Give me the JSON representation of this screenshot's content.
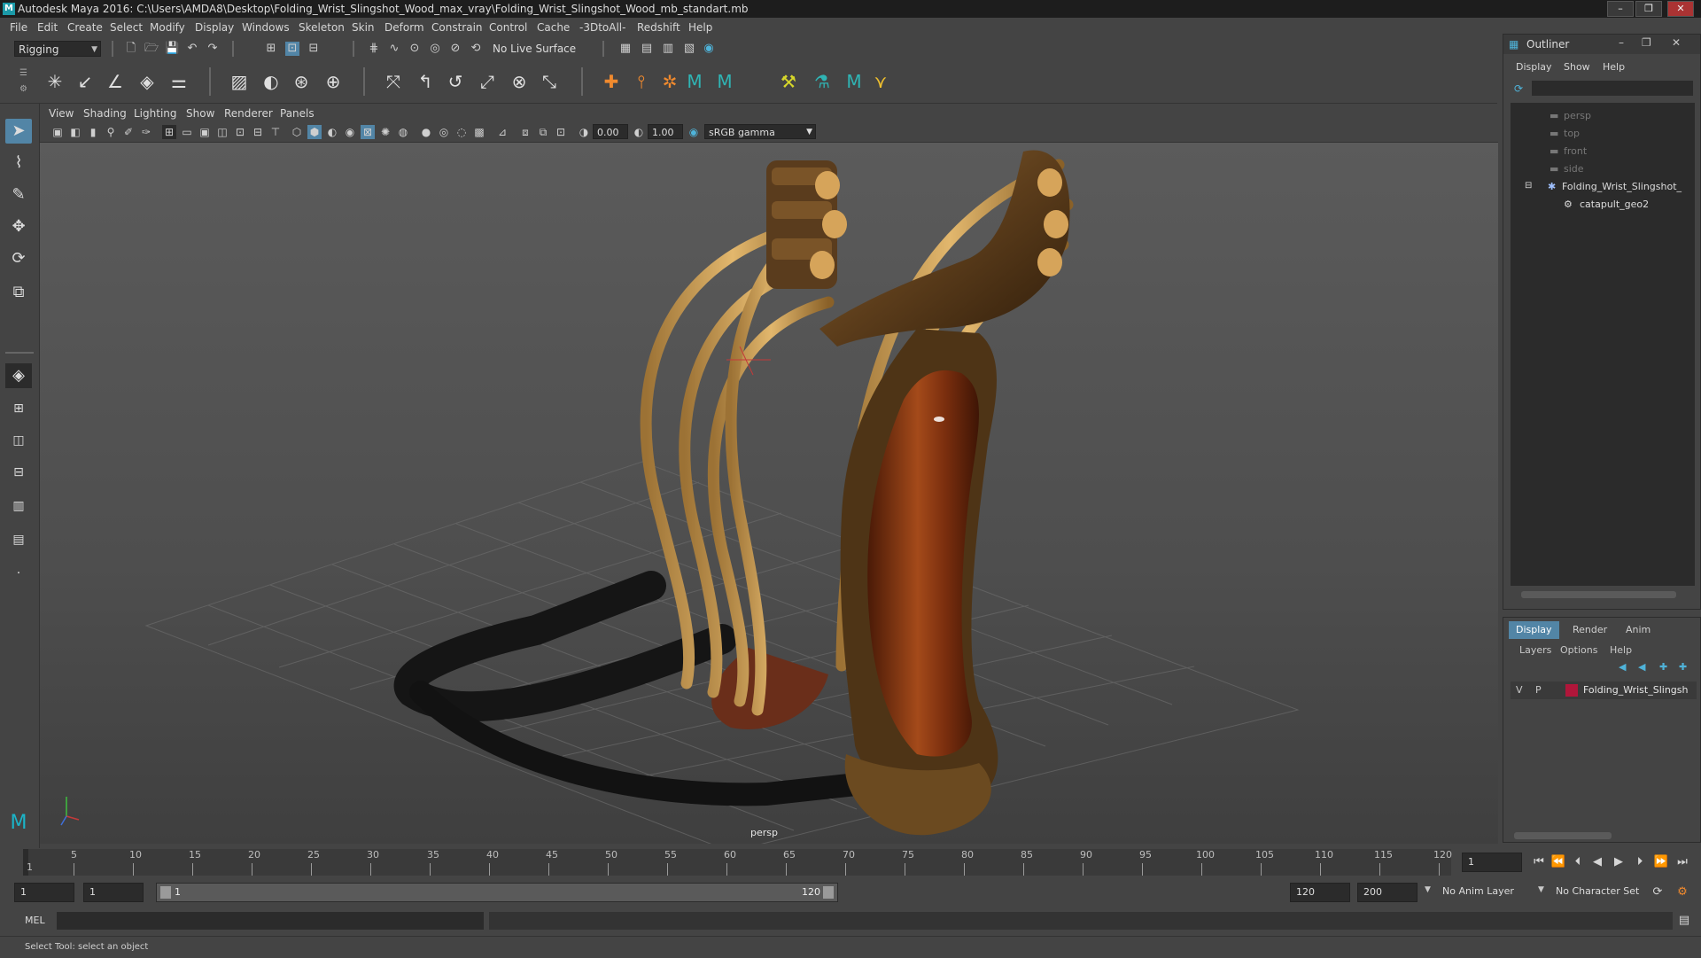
{
  "window": {
    "title": "Autodesk Maya 2016: C:\\Users\\AMDA8\\Desktop\\Folding_Wrist_Slingshot_Wood_max_vray\\Folding_Wrist_Slingshot_Wood_mb_standart.mb",
    "minimize": "–",
    "maximize": "❐",
    "close": "✕"
  },
  "menubar": [
    "File",
    "Edit",
    "Create",
    "Select",
    "Modify",
    "Display",
    "Windows",
    "Skeleton",
    "Skin",
    "Deform",
    "Constrain",
    "Control",
    "Cache",
    "-3DtoAll-",
    "Redshift",
    "Help"
  ],
  "statusline": {
    "mode_menu": "Rigging",
    "live_surface": "No Live Surface"
  },
  "panel_menu": [
    "View",
    "Shading",
    "Lighting",
    "Show",
    "Renderer",
    "Panels"
  ],
  "panel_tools": {
    "exposure": "0.00",
    "gamma": "1.00",
    "color_space": "sRGB gamma"
  },
  "viewport": {
    "camera_label": "persp"
  },
  "outliner": {
    "title": "Outliner",
    "menu": [
      "Display",
      "Show",
      "Help"
    ],
    "items": [
      {
        "label": "persp",
        "active": false
      },
      {
        "label": "top",
        "active": false
      },
      {
        "label": "front",
        "active": false
      },
      {
        "label": "side",
        "active": false
      },
      {
        "label": "Folding_Wrist_Slingshot_",
        "active": true
      },
      {
        "label": "catapult_geo2",
        "active": true
      }
    ]
  },
  "layer_editor": {
    "tabs": [
      "Display",
      "Render",
      "Anim"
    ],
    "menu": [
      "Layers",
      "Options",
      "Help"
    ],
    "layer": {
      "v": "V",
      "p": "P",
      "name": "Folding_Wrist_Slingsh",
      "color": "#b0163a"
    }
  },
  "time_slider": {
    "labels": [
      "1",
      "5",
      "10",
      "15",
      "20",
      "25",
      "30",
      "35",
      "40",
      "45",
      "50",
      "55",
      "60",
      "65",
      "70",
      "75",
      "80",
      "85",
      "90",
      "95",
      "100",
      "105",
      "110",
      "115",
      "120"
    ],
    "current_frame": "1"
  },
  "range_slider": {
    "start": "1",
    "playback_start": "1",
    "range_start_label": "1",
    "range_end_label": "120",
    "playback_end": "120",
    "end": "200",
    "anim_layer": "No Anim Layer",
    "character_set": "No Character Set"
  },
  "command_line": {
    "label": "MEL"
  },
  "help_line": {
    "text": "Select Tool: select an object"
  },
  "colors": {
    "ui_bg": "#444444",
    "highlight": "#5285a6",
    "wood": "#8a3d15",
    "rubber": "#c89a52",
    "strap": "#1a1a1a"
  }
}
